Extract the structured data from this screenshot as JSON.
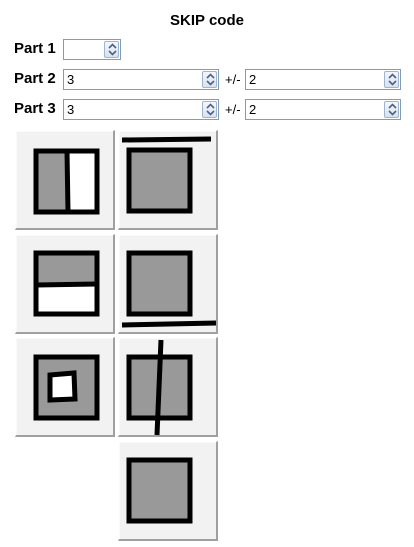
{
  "title": "SKIP code",
  "part1": {
    "label": "Part 1",
    "value": ""
  },
  "part2": {
    "label": "Part 2",
    "value": "3",
    "tolerance_label": "+/-",
    "tolerance_value": "2"
  },
  "part3": {
    "label": "Part 3",
    "value": "3",
    "tolerance_label": "+/-",
    "tolerance_value": "2"
  },
  "tiles": [
    {
      "name": "vertical-split-icon"
    },
    {
      "name": "top-line-icon"
    },
    {
      "name": "horizontal-split-icon"
    },
    {
      "name": "bottom-line-icon"
    },
    {
      "name": "enclosed-square-icon"
    },
    {
      "name": "vertical-stroke-icon"
    },
    {
      "name": "plain-square-icon"
    }
  ]
}
